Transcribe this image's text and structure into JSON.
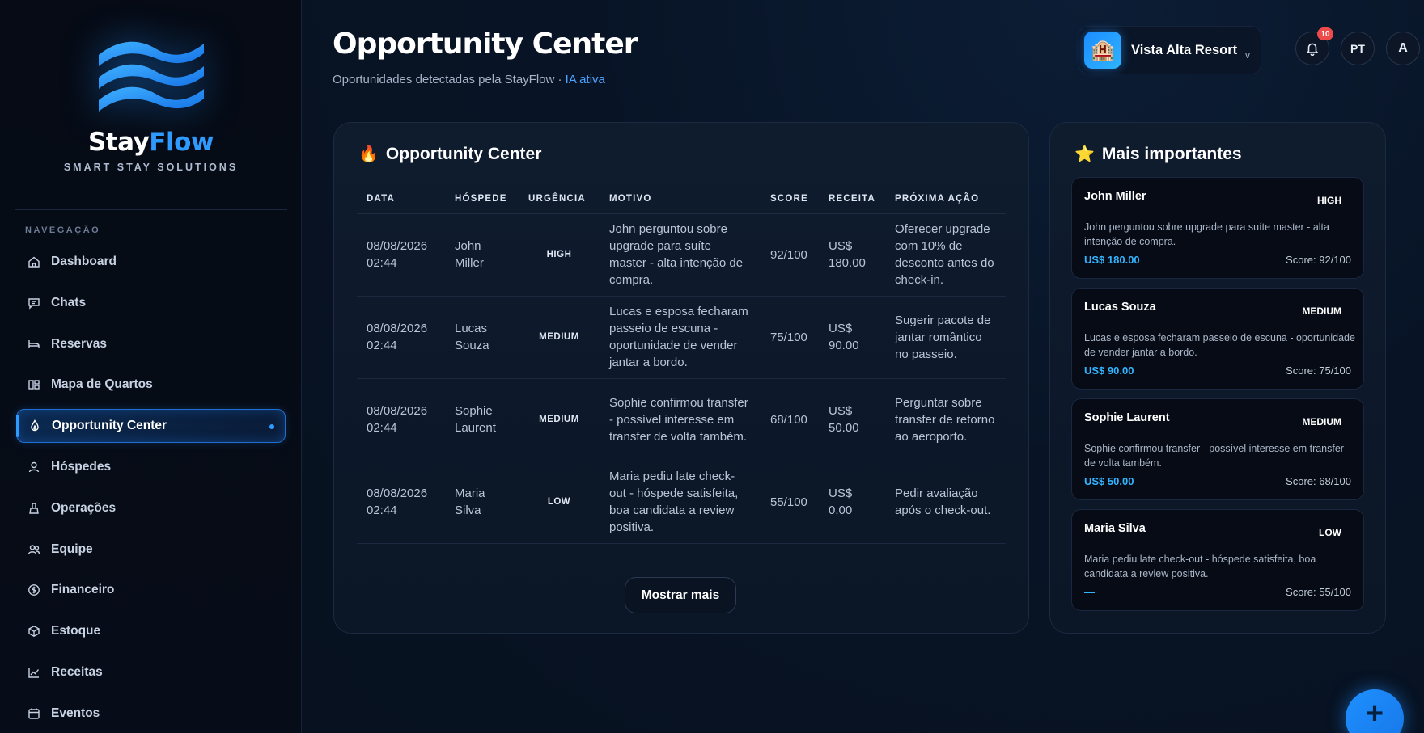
{
  "brand": {
    "name_part1": "Stay",
    "name_part2": "Flow",
    "tagline": "SMART STAY SOLUTIONS"
  },
  "sidebar": {
    "section_title": "NAVEGAÇÃO",
    "items": [
      {
        "label": "Dashboard",
        "icon": "home-icon"
      },
      {
        "label": "Chats",
        "icon": "chat-icon"
      },
      {
        "label": "Reservas",
        "icon": "bed-icon"
      },
      {
        "label": "Mapa de Quartos",
        "icon": "map-icon"
      },
      {
        "label": "Opportunity Center",
        "icon": "flame-icon",
        "active": true
      },
      {
        "label": "Hóspedes",
        "icon": "user-icon"
      },
      {
        "label": "Operações",
        "icon": "broom-icon"
      },
      {
        "label": "Equipe",
        "icon": "team-icon"
      },
      {
        "label": "Financeiro",
        "icon": "dollar-icon"
      },
      {
        "label": "Estoque",
        "icon": "box-icon"
      },
      {
        "label": "Receitas",
        "icon": "chart-icon"
      },
      {
        "label": "Eventos",
        "icon": "calendar-icon"
      }
    ]
  },
  "header": {
    "title": "Opportunity Center",
    "subtitle": "Oportunidades detectadas pela StayFlow ·",
    "subtitle_status": "IA ativa",
    "hotel_name": "Vista Alta Resort",
    "hotel_chevron": "v",
    "notifications_count": "10",
    "language": "PT",
    "avatar_initial": "A"
  },
  "opportunities_panel": {
    "title": "Opportunity Center",
    "columns": [
      "DATA",
      "HÓSPEDE",
      "URGÊNCIA",
      "MOTIVO",
      "SCORE",
      "RECEITA",
      "PRÓXIMA AÇÃO"
    ],
    "rows": [
      {
        "date": "08/08/2026 02:44",
        "guest": "John Miller",
        "urgency": "HIGH",
        "reason": "John perguntou sobre upgrade para suíte master - alta intenção de compra.",
        "score": "92/100",
        "revenue": "US$ 180.00",
        "next_action": "Oferecer upgrade com 10% de desconto antes do check-in."
      },
      {
        "date": "08/08/2026 02:44",
        "guest": "Lucas Souza",
        "urgency": "MEDIUM",
        "reason": "Lucas e esposa fecharam passeio de escuna - oportunidade de vender jantar a bordo.",
        "score": "75/100",
        "revenue": "US$ 90.00",
        "next_action": "Sugerir pacote de jantar romântico no passeio."
      },
      {
        "date": "08/08/2026 02:44",
        "guest": "Sophie Laurent",
        "urgency": "MEDIUM",
        "reason": "Sophie confirmou transfer - possível interesse em transfer de volta também.",
        "score": "68/100",
        "revenue": "US$ 50.00",
        "next_action": "Perguntar sobre transfer de retorno ao aeroporto."
      },
      {
        "date": "08/08/2026 02:44",
        "guest": "Maria Silva",
        "urgency": "LOW",
        "reason": "Maria pediu late check-out - hóspede satisfeita, boa candidata a review positiva.",
        "score": "55/100",
        "revenue": "US$ 0.00",
        "next_action": "Pedir avaliação após o check-out."
      }
    ],
    "show_more_label": "Mostrar mais"
  },
  "top_panel": {
    "title": "Mais importantes",
    "cards": [
      {
        "name": "John Miller",
        "urgency": "HIGH",
        "description": "John perguntou sobre upgrade para suíte master - alta intenção de compra.",
        "revenue": "US$ 180.00",
        "score": "Score: 92/100"
      },
      {
        "name": "Lucas Souza",
        "urgency": "MEDIUM",
        "description": "Lucas e esposa fecharam passeio de escuna - oportunidade de vender jantar a bordo.",
        "revenue": "US$ 90.00",
        "score": "Score: 75/100"
      },
      {
        "name": "Sophie Laurent",
        "urgency": "MEDIUM",
        "description": "Sophie confirmou transfer - possível interesse em transfer de volta também.",
        "revenue": "US$ 50.00",
        "score": "Score: 68/100"
      },
      {
        "name": "Maria Silva",
        "urgency": "LOW",
        "description": "Maria pediu late check-out - hóspede satisfeita, boa candidata a review positiva.",
        "revenue": "—",
        "score": "Score: 55/100"
      }
    ]
  },
  "fab": {
    "label": "+"
  },
  "colors": {
    "accent": "#2f9bff",
    "revenue": "#34b4ff",
    "badge": "#ef4a4a",
    "background": "#071120"
  }
}
